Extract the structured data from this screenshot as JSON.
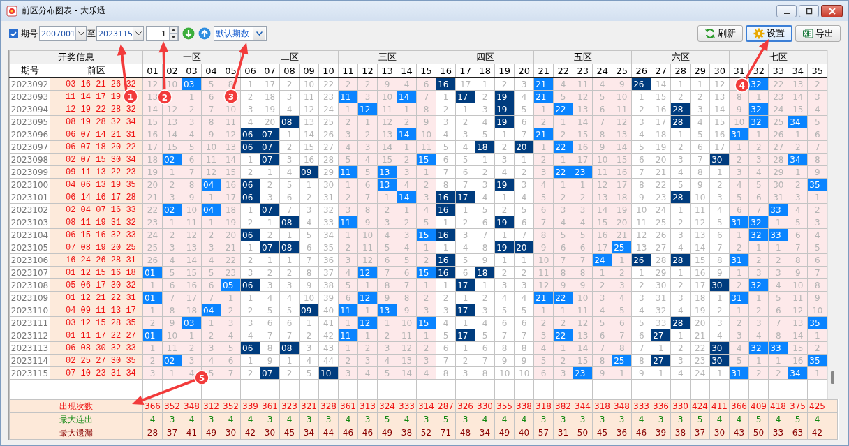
{
  "window": {
    "title": "前区分布图表 - 大乐透"
  },
  "toolbar": {
    "issue_filter": {
      "label": "期号",
      "checked": true
    },
    "from": "2007001",
    "to_label": "至",
    "to": "2023115",
    "step": "1",
    "period_mode": "默认期数",
    "buttons": [
      {
        "label": "刷新",
        "kind": "refresh",
        "focused": false
      },
      {
        "label": "设置",
        "kind": "settings",
        "focused": true
      },
      {
        "label": "导出",
        "kind": "export",
        "focused": false
      }
    ]
  },
  "table": {
    "group_header": "开奖信息",
    "issue_header": "期号",
    "draw_header": "前区",
    "zones": [
      {
        "label": "一区",
        "columns": [
          "01",
          "02",
          "03",
          "04",
          "05"
        ]
      },
      {
        "label": "二区",
        "columns": [
          "06",
          "07",
          "08",
          "09",
          "10"
        ]
      },
      {
        "label": "三区",
        "columns": [
          "11",
          "12",
          "13",
          "14",
          "15"
        ]
      },
      {
        "label": "四区",
        "columns": [
          "16",
          "17",
          "18",
          "19",
          "20"
        ]
      },
      {
        "label": "五区",
        "columns": [
          "21",
          "22",
          "23",
          "24",
          "25"
        ]
      },
      {
        "label": "六区",
        "columns": [
          "26",
          "27",
          "28",
          "29",
          "30"
        ]
      },
      {
        "label": "七区",
        "columns": [
          "31",
          "32",
          "33",
          "34",
          "35"
        ]
      }
    ],
    "rows": [
      {
        "issue": "2023092",
        "draw": "03 16 21 26 32",
        "cells": [
          "12",
          "10",
          "03",
          "5",
          "8",
          "1",
          "17",
          "2",
          "10",
          "22",
          "2",
          "2",
          "9",
          "4",
          "6",
          "16",
          "17",
          "1",
          "2",
          "3",
          "21",
          "4",
          "11",
          "4",
          "9",
          "26",
          "14",
          "1",
          "1",
          "12",
          null,
          "32",
          "22",
          "13",
          "2"
        ],
        "hit": [
          false,
          false,
          true,
          false,
          false,
          false,
          false,
          false,
          false,
          false,
          false,
          false,
          false,
          false,
          false,
          true,
          false,
          false,
          false,
          false,
          true,
          false,
          false,
          false,
          false,
          true,
          false,
          false,
          false,
          false,
          false,
          true,
          false,
          false,
          false
        ]
      },
      {
        "issue": "2023093",
        "draw": "11 14 17 19",
        "cells": [
          "13",
          null,
          "1",
          "6",
          null,
          "2",
          "18",
          "3",
          "11",
          "23",
          "11",
          "3",
          "10",
          "14",
          "7",
          "1",
          "17",
          "2",
          "19",
          "4",
          "21",
          "5",
          "12",
          "5",
          "10",
          "1",
          "15",
          "2",
          "2",
          "13",
          "8",
          "1",
          "23",
          "14",
          "3"
        ],
        "hit": [
          false,
          false,
          false,
          false,
          false,
          false,
          false,
          false,
          false,
          false,
          true,
          false,
          false,
          true,
          false,
          false,
          true,
          false,
          true,
          false,
          true,
          false,
          false,
          false,
          false,
          false,
          false,
          false,
          false,
          false,
          false,
          false,
          false,
          false,
          false
        ]
      },
      {
        "issue": "2023094",
        "draw": "12 19 22 28 32",
        "cells": [
          "14",
          "12",
          "2",
          "7",
          "10",
          "3",
          "19",
          "4",
          "12",
          "24",
          "1",
          "12",
          "11",
          "1",
          "8",
          "2",
          "1",
          "3",
          "19",
          "5",
          "1",
          "22",
          "13",
          "6",
          "11",
          "2",
          "16",
          "28",
          "3",
          "14",
          "9",
          "32",
          "24",
          "15",
          "4"
        ],
        "hit": [
          false,
          false,
          false,
          false,
          false,
          false,
          false,
          false,
          false,
          false,
          false,
          true,
          false,
          false,
          false,
          false,
          false,
          false,
          true,
          false,
          false,
          true,
          false,
          false,
          false,
          false,
          false,
          true,
          false,
          false,
          false,
          true,
          false,
          false,
          false
        ]
      },
      {
        "issue": "2023095",
        "draw": "08 19 28 32 34",
        "cells": [
          "15",
          "13",
          "3",
          "8",
          "11",
          "4",
          "20",
          "08",
          "13",
          "25",
          "2",
          "1",
          "12",
          "2",
          "9",
          "3",
          "2",
          "4",
          "19",
          "6",
          "2",
          "1",
          "14",
          "7",
          "12",
          "3",
          "17",
          "28",
          "4",
          "15",
          "10",
          "32",
          "25",
          "34",
          "5"
        ],
        "hit": [
          false,
          false,
          false,
          false,
          false,
          false,
          false,
          true,
          false,
          false,
          false,
          false,
          false,
          false,
          false,
          false,
          false,
          false,
          true,
          false,
          false,
          false,
          false,
          false,
          false,
          false,
          false,
          true,
          false,
          false,
          false,
          true,
          false,
          true,
          false
        ]
      },
      {
        "issue": "2023096",
        "draw": "06 07 14 21 31",
        "cells": [
          "16",
          "14",
          "4",
          "9",
          "12",
          "06",
          "07",
          "1",
          "14",
          "26",
          "3",
          "2",
          "13",
          "14",
          "10",
          "4",
          "3",
          "5",
          "1",
          "7",
          "21",
          "2",
          "15",
          "8",
          "13",
          "4",
          "18",
          "1",
          "5",
          "16",
          "31",
          "1",
          "26",
          "1",
          "6"
        ],
        "hit": [
          false,
          false,
          false,
          false,
          false,
          true,
          true,
          false,
          false,
          false,
          false,
          false,
          false,
          true,
          false,
          false,
          false,
          false,
          false,
          false,
          true,
          false,
          false,
          false,
          false,
          false,
          false,
          false,
          false,
          false,
          true,
          false,
          false,
          false,
          false
        ]
      },
      {
        "issue": "2023097",
        "draw": "06 07 18 20 22",
        "cells": [
          "17",
          "15",
          "5",
          "10",
          "13",
          "06",
          "07",
          "2",
          "15",
          "27",
          "4",
          "3",
          "14",
          "1",
          "11",
          "5",
          "4",
          "18",
          "2",
          "20",
          "1",
          "22",
          "16",
          "9",
          "14",
          "5",
          "19",
          "2",
          "6",
          "17",
          "1",
          "2",
          "27",
          "2",
          "7"
        ],
        "hit": [
          false,
          false,
          false,
          false,
          false,
          true,
          true,
          false,
          false,
          false,
          false,
          false,
          false,
          false,
          false,
          false,
          false,
          true,
          false,
          true,
          false,
          true,
          false,
          false,
          false,
          false,
          false,
          false,
          false,
          false,
          false,
          false,
          false,
          false,
          false
        ]
      },
      {
        "issue": "2023098",
        "draw": "02 07 15 30 34",
        "cells": [
          "18",
          "02",
          "6",
          "11",
          "14",
          "1",
          "07",
          "3",
          "16",
          "28",
          "5",
          "4",
          "15",
          "2",
          "15",
          "6",
          "5",
          "1",
          "3",
          "1",
          "2",
          "1",
          "17",
          "10",
          "15",
          "6",
          "20",
          "3",
          "7",
          "30",
          "2",
          "3",
          "28",
          "34",
          "8"
        ],
        "hit": [
          false,
          true,
          false,
          false,
          false,
          false,
          true,
          false,
          false,
          false,
          false,
          false,
          false,
          false,
          true,
          false,
          false,
          false,
          false,
          false,
          false,
          false,
          false,
          false,
          false,
          false,
          false,
          false,
          false,
          true,
          false,
          false,
          false,
          true,
          false
        ]
      },
      {
        "issue": "2023099",
        "draw": "09 11 13 22 23",
        "cells": [
          "19",
          "1",
          "7",
          "12",
          "15",
          "2",
          "1",
          "4",
          "09",
          "29",
          "11",
          "5",
          "13",
          "3",
          "1",
          "7",
          "6",
          "2",
          "4",
          "2",
          "3",
          "22",
          "23",
          "11",
          "16",
          "7",
          "21",
          "4",
          "8",
          "1",
          "3",
          "4",
          "29",
          "1",
          "9"
        ],
        "hit": [
          false,
          false,
          false,
          false,
          false,
          false,
          false,
          false,
          true,
          false,
          true,
          false,
          true,
          false,
          false,
          false,
          false,
          false,
          false,
          false,
          false,
          true,
          true,
          false,
          false,
          false,
          false,
          false,
          false,
          false,
          false,
          false,
          false,
          false,
          false
        ]
      },
      {
        "issue": "2023100",
        "draw": "04 06 13 19 35",
        "cells": [
          "20",
          "2",
          "8",
          "04",
          "16",
          "06",
          "2",
          "5",
          "1",
          "30",
          "1",
          "6",
          "13",
          "4",
          "2",
          "8",
          "7",
          "3",
          "19",
          "3",
          "4",
          "1",
          "1",
          "12",
          "17",
          "8",
          "22",
          "5",
          "9",
          "2",
          "4",
          "5",
          "30",
          "2",
          "35"
        ],
        "hit": [
          false,
          false,
          false,
          true,
          false,
          true,
          false,
          false,
          false,
          false,
          false,
          false,
          true,
          false,
          false,
          false,
          false,
          false,
          true,
          false,
          false,
          false,
          false,
          false,
          false,
          false,
          false,
          false,
          false,
          false,
          false,
          false,
          false,
          false,
          true
        ]
      },
      {
        "issue": "2023101",
        "draw": "06 14 16 17 28",
        "cells": [
          "21",
          "3",
          "9",
          "1",
          "17",
          "06",
          "3",
          "6",
          "2",
          "31",
          "2",
          "7",
          "1",
          "14",
          "3",
          "16",
          "17",
          "4",
          "1",
          "4",
          "5",
          "2",
          "2",
          "13",
          "18",
          "9",
          "23",
          "28",
          "10",
          "3",
          "5",
          "6",
          "31",
          "3",
          "1"
        ],
        "hit": [
          false,
          false,
          false,
          false,
          false,
          true,
          false,
          false,
          false,
          false,
          false,
          false,
          false,
          true,
          false,
          true,
          true,
          false,
          false,
          false,
          false,
          false,
          false,
          false,
          false,
          false,
          false,
          true,
          false,
          false,
          false,
          false,
          false,
          false,
          false
        ]
      },
      {
        "issue": "2023102",
        "draw": "02 04 07 16 33",
        "cells": [
          "22",
          "02",
          "10",
          "04",
          "18",
          "1",
          "07",
          "7",
          "3",
          "32",
          "3",
          "8",
          "2",
          "1",
          "4",
          "16",
          "1",
          "5",
          "2",
          "5",
          "6",
          "3",
          "3",
          "14",
          "19",
          "10",
          "24",
          "1",
          "11",
          "4",
          "6",
          "7",
          "33",
          "4",
          "2"
        ],
        "hit": [
          false,
          true,
          false,
          true,
          false,
          false,
          true,
          false,
          false,
          false,
          false,
          false,
          false,
          false,
          false,
          true,
          false,
          false,
          false,
          false,
          false,
          false,
          false,
          false,
          false,
          false,
          false,
          false,
          false,
          false,
          false,
          false,
          true,
          false,
          false
        ]
      },
      {
        "issue": "2023103",
        "draw": "08 11 19 31 32",
        "cells": [
          "23",
          "1",
          "11",
          "1",
          "19",
          "2",
          "1",
          "08",
          "4",
          "33",
          "11",
          "9",
          "3",
          "2",
          "5",
          "1",
          "2",
          "6",
          "19",
          "6",
          "7",
          "4",
          "4",
          "15",
          "20",
          "11",
          "25",
          "2",
          "12",
          "5",
          "31",
          "32",
          "1",
          "5",
          "3"
        ],
        "hit": [
          false,
          false,
          false,
          false,
          false,
          false,
          false,
          true,
          false,
          false,
          true,
          false,
          false,
          false,
          false,
          false,
          false,
          false,
          true,
          false,
          false,
          false,
          false,
          false,
          false,
          false,
          false,
          false,
          false,
          false,
          true,
          true,
          false,
          false,
          false
        ]
      },
      {
        "issue": "2023104",
        "draw": "06 15 16 32 33",
        "cells": [
          "24",
          "2",
          "12",
          "2",
          "20",
          "06",
          "2",
          "1",
          "5",
          "34",
          "1",
          "10",
          "4",
          "3",
          "15",
          "16",
          "3",
          "7",
          "1",
          "7",
          "8",
          "5",
          "5",
          "16",
          "21",
          "12",
          "26",
          "3",
          "13",
          "6",
          "1",
          "32",
          "33",
          "6",
          "4"
        ],
        "hit": [
          false,
          false,
          false,
          false,
          false,
          true,
          false,
          false,
          false,
          false,
          false,
          false,
          false,
          false,
          true,
          true,
          false,
          false,
          false,
          false,
          false,
          false,
          false,
          false,
          false,
          false,
          false,
          false,
          false,
          false,
          false,
          true,
          true,
          false,
          false
        ]
      },
      {
        "issue": "2023105",
        "draw": "07 08 19 20 25",
        "cells": [
          "25",
          "3",
          "13",
          "3",
          "21",
          "1",
          "07",
          "08",
          "6",
          "35",
          "2",
          "11",
          "5",
          "4",
          "1",
          "1",
          "4",
          "8",
          "19",
          "20",
          "9",
          "6",
          "6",
          "17",
          "25",
          "13",
          "27",
          "4",
          "14",
          "7",
          "2",
          "1",
          "1",
          "7",
          "5"
        ],
        "hit": [
          false,
          false,
          false,
          false,
          false,
          false,
          true,
          true,
          false,
          false,
          false,
          false,
          false,
          false,
          false,
          false,
          false,
          false,
          true,
          true,
          false,
          false,
          false,
          false,
          true,
          false,
          false,
          false,
          false,
          false,
          false,
          false,
          false,
          false,
          false
        ]
      },
      {
        "issue": "2023106",
        "draw": "16 24 26 28 31",
        "cells": [
          "26",
          "4",
          "14",
          "4",
          "22",
          "2",
          "1",
          "1",
          "7",
          "36",
          "3",
          "12",
          "6",
          "5",
          "2",
          "16",
          "5",
          "9",
          "1",
          "1",
          "10",
          "7",
          "7",
          "24",
          "1",
          "26",
          "28",
          "28",
          "15",
          "8",
          "31",
          "2",
          "2",
          "8",
          "6"
        ],
        "hit": [
          false,
          false,
          false,
          false,
          false,
          false,
          false,
          false,
          false,
          false,
          false,
          false,
          false,
          false,
          false,
          true,
          false,
          false,
          false,
          false,
          false,
          false,
          false,
          true,
          false,
          true,
          false,
          true,
          false,
          false,
          true,
          false,
          false,
          false,
          false
        ]
      },
      {
        "issue": "2023107",
        "draw": "01 12 15 16 18",
        "cells": [
          "01",
          "5",
          "15",
          "5",
          "23",
          "3",
          "2",
          "2",
          "8",
          "37",
          "4",
          "12",
          "7",
          "6",
          "15",
          "16",
          "6",
          "18",
          "2",
          "2",
          "11",
          "8",
          "8",
          "1",
          "2",
          "1",
          "29",
          "1",
          "16",
          "9",
          "1",
          "3",
          "3",
          "9",
          "7"
        ],
        "hit": [
          true,
          false,
          false,
          false,
          false,
          false,
          false,
          false,
          false,
          false,
          false,
          true,
          false,
          false,
          true,
          true,
          false,
          true,
          false,
          false,
          false,
          false,
          false,
          false,
          false,
          false,
          false,
          false,
          false,
          false,
          false,
          false,
          false,
          false,
          false
        ]
      },
      {
        "issue": "2023108",
        "draw": "05 06 17 30 32",
        "cells": [
          "1",
          "6",
          "16",
          "6",
          "05",
          "06",
          "3",
          "3",
          "9",
          "38",
          "5",
          "1",
          "8",
          "7",
          "1",
          "1",
          "17",
          "1",
          "3",
          "3",
          "12",
          "9",
          "9",
          "2",
          "3",
          "2",
          "30",
          "2",
          "17",
          "30",
          "2",
          "32",
          "4",
          "10",
          "8"
        ],
        "hit": [
          false,
          false,
          false,
          false,
          true,
          true,
          false,
          false,
          false,
          false,
          false,
          false,
          false,
          false,
          false,
          false,
          true,
          false,
          false,
          false,
          false,
          false,
          false,
          false,
          false,
          false,
          false,
          false,
          false,
          true,
          false,
          true,
          false,
          false,
          false
        ]
      },
      {
        "issue": "2023109",
        "draw": "01 12 21 22 31",
        "cells": [
          "01",
          "7",
          "17",
          "7",
          "1",
          "1",
          "4",
          "4",
          "10",
          "39",
          "6",
          "12",
          "9",
          "8",
          "2",
          "2",
          "1",
          "2",
          "4",
          "4",
          "21",
          "22",
          "10",
          "3",
          "4",
          "3",
          "31",
          "3",
          "18",
          "1",
          "31",
          "1",
          "5",
          "11",
          "9"
        ],
        "hit": [
          true,
          false,
          false,
          false,
          false,
          false,
          false,
          false,
          false,
          false,
          false,
          true,
          false,
          false,
          false,
          false,
          false,
          false,
          false,
          false,
          true,
          true,
          false,
          false,
          false,
          false,
          false,
          false,
          false,
          false,
          true,
          false,
          false,
          false,
          false
        ]
      },
      {
        "issue": "2023110",
        "draw": "04 09 11 13 17",
        "cells": [
          "1",
          "8",
          "18",
          "04",
          "2",
          "2",
          "5",
          "5",
          "09",
          "40",
          "11",
          "1",
          "13",
          "9",
          "3",
          "3",
          "17",
          "3",
          "5",
          "5",
          "1",
          "1",
          "11",
          "4",
          "5",
          "4",
          "32",
          "4",
          "19",
          "2",
          "1",
          "2",
          "6",
          "12",
          "10"
        ],
        "hit": [
          false,
          false,
          false,
          true,
          false,
          false,
          false,
          false,
          true,
          false,
          true,
          false,
          true,
          false,
          false,
          false,
          true,
          false,
          false,
          false,
          false,
          false,
          false,
          false,
          false,
          false,
          false,
          false,
          false,
          false,
          false,
          false,
          false,
          false,
          false
        ]
      },
      {
        "issue": "2023111",
        "draw": "03 12 15 28 35",
        "cells": [
          "2",
          "9",
          "03",
          "1",
          "3",
          "3",
          "6",
          "6",
          "1",
          "41",
          "1",
          "12",
          "1",
          "10",
          "15",
          "4",
          "1",
          "4",
          "6",
          "6",
          "2",
          "2",
          "12",
          "5",
          "6",
          "5",
          "33",
          "28",
          "20",
          "3",
          "2",
          "3",
          "7",
          "13",
          "35"
        ],
        "hit": [
          false,
          false,
          true,
          false,
          false,
          false,
          false,
          false,
          false,
          false,
          false,
          true,
          false,
          false,
          true,
          false,
          false,
          false,
          false,
          false,
          false,
          false,
          false,
          false,
          false,
          false,
          false,
          true,
          false,
          false,
          false,
          false,
          false,
          false,
          true
        ]
      },
      {
        "issue": "2023112",
        "draw": "01 11 17 22 27",
        "cells": [
          "01",
          "10",
          "1",
          "2",
          "4",
          "4",
          "7",
          "7",
          "2",
          "42",
          "11",
          "1",
          "2",
          "11",
          "1",
          "5",
          "17",
          "5",
          "7",
          "7",
          "3",
          "22",
          "13",
          "6",
          "7",
          "6",
          "27",
          "1",
          "21",
          "4",
          "3",
          "4",
          "8",
          "14",
          "1"
        ],
        "hit": [
          true,
          false,
          false,
          false,
          false,
          false,
          false,
          false,
          false,
          false,
          true,
          false,
          false,
          false,
          false,
          false,
          true,
          false,
          false,
          false,
          false,
          true,
          false,
          false,
          false,
          false,
          true,
          false,
          false,
          false,
          false,
          false,
          false,
          false,
          false
        ]
      },
      {
        "issue": "2023113",
        "draw": "06 08 30 32 33",
        "cells": [
          "1",
          "11",
          "2",
          "3",
          "5",
          "06",
          "8",
          "08",
          "3",
          "43",
          "1",
          "2",
          "3",
          "12",
          "2",
          "6",
          "1",
          "6",
          "8",
          "8",
          "4",
          "1",
          "14",
          "7",
          "8",
          "7",
          "1",
          "2",
          "22",
          "30",
          "4",
          "32",
          "33",
          "15",
          "2"
        ],
        "hit": [
          false,
          false,
          false,
          false,
          false,
          true,
          false,
          true,
          false,
          false,
          false,
          false,
          false,
          false,
          false,
          false,
          false,
          false,
          false,
          false,
          false,
          false,
          false,
          false,
          false,
          false,
          false,
          false,
          false,
          true,
          false,
          true,
          true,
          false,
          false
        ]
      },
      {
        "issue": "2023114",
        "draw": "02 25 27 30 35",
        "cells": [
          "2",
          "02",
          "3",
          "4",
          "6",
          "1",
          "9",
          "1",
          "4",
          "44",
          "2",
          "3",
          "4",
          "13",
          "3",
          "7",
          "2",
          "7",
          "9",
          "9",
          "5",
          "2",
          "15",
          "8",
          "25",
          "8",
          "27",
          "3",
          "23",
          "30",
          "5",
          "1",
          "1",
          "16",
          "35"
        ],
        "hit": [
          false,
          true,
          false,
          false,
          false,
          false,
          false,
          false,
          false,
          false,
          false,
          false,
          false,
          false,
          false,
          false,
          false,
          false,
          false,
          false,
          false,
          false,
          false,
          false,
          true,
          false,
          true,
          false,
          false,
          true,
          false,
          false,
          false,
          false,
          true
        ]
      },
      {
        "issue": "2023115",
        "draw": "07 10 23 31 34",
        "cells": [
          "3",
          "1",
          "4",
          "5",
          "7",
          "2",
          "07",
          "2",
          "5",
          "10",
          "3",
          "4",
          "5",
          "14",
          "4",
          "8",
          "3",
          "8",
          "10",
          "10",
          "6",
          "3",
          "23",
          "9",
          "1",
          "9",
          "1",
          "4",
          "24",
          "1",
          "31",
          "2",
          "2",
          "34",
          "1"
        ],
        "hit": [
          false,
          false,
          false,
          false,
          false,
          false,
          true,
          false,
          false,
          true,
          false,
          false,
          false,
          false,
          false,
          false,
          false,
          false,
          false,
          false,
          false,
          false,
          true,
          false,
          false,
          false,
          false,
          false,
          false,
          false,
          true,
          false,
          false,
          true,
          false
        ]
      }
    ]
  },
  "summary": [
    {
      "kind": "count",
      "label": "出现次数",
      "values": [
        "366",
        "352",
        "348",
        "312",
        "352",
        "339",
        "361",
        "323",
        "321",
        "328",
        "361",
        "313",
        "324",
        "333",
        "314",
        "287",
        "326",
        "330",
        "355",
        "338",
        "318",
        "382",
        "344",
        "318",
        "348",
        "333",
        "336",
        "330",
        "424",
        "411",
        "366",
        "409",
        "418",
        "375",
        "425"
      ]
    },
    {
      "kind": "streak",
      "label": "最大连出",
      "values": [
        "4",
        "3",
        "4",
        "3",
        "4",
        "4",
        "3",
        "4",
        "3",
        "3",
        "4",
        "3",
        "5",
        "4",
        "3",
        "5",
        "3",
        "4",
        "4",
        "4",
        "3",
        "3",
        "3",
        "3",
        "3",
        "4",
        "3",
        "3",
        "5",
        "4",
        "4",
        "5",
        "4",
        "5",
        "4"
      ]
    },
    {
      "kind": "omission",
      "label": "最大遗漏",
      "values": [
        "28",
        "37",
        "41",
        "49",
        "30",
        "42",
        "30",
        "45",
        "34",
        "44",
        "46",
        "46",
        "49",
        "38",
        "52",
        "71",
        "48",
        "34",
        "49",
        "40",
        "57",
        "31",
        "50",
        "45",
        "36",
        "46",
        "39",
        "38",
        "37",
        "30",
        "43",
        "50",
        "33",
        "63",
        "42"
      ]
    }
  ],
  "annotations": [
    {
      "label": "1"
    },
    {
      "label": "2"
    },
    {
      "label": "3"
    },
    {
      "label": "4"
    },
    {
      "label": "5"
    }
  ]
}
